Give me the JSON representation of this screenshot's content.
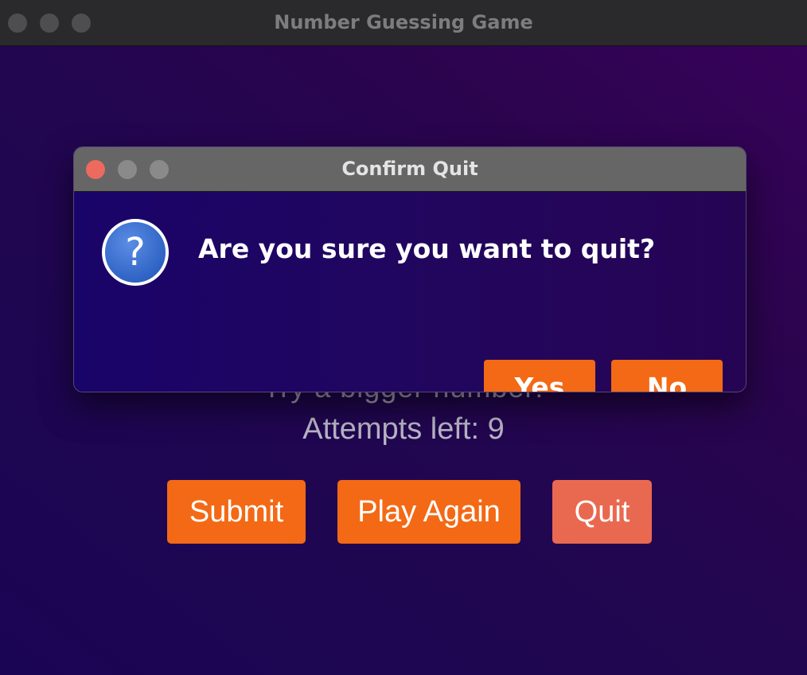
{
  "main_window": {
    "title": "Number Guessing Game",
    "feedback_text": "Try a bigger number!",
    "attempts_text": "Attempts left: 9",
    "buttons": {
      "submit": "Submit",
      "play_again": "Play Again",
      "quit": "Quit"
    }
  },
  "dialog": {
    "title": "Confirm Quit",
    "icon": "question-icon",
    "icon_glyph": "?",
    "message": "Are you sure you want to quit?",
    "buttons": {
      "yes": "Yes",
      "no": "No"
    }
  },
  "colors": {
    "accent_orange": "#f36915",
    "quit_button": "#e96950",
    "close_red": "#ec6a5e",
    "background_purple": "#210650"
  }
}
